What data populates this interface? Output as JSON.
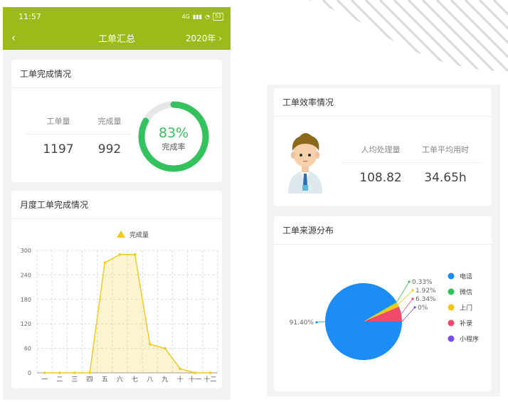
{
  "status": {
    "time": "11:57",
    "network": "4G",
    "battery": "53"
  },
  "nav": {
    "back_icon": "chevron-left-icon",
    "title": "工单汇总",
    "year": "2020年",
    "next_icon": "chevron-right-icon"
  },
  "completion": {
    "title": "工单完成情况",
    "total_label": "工单量",
    "total_value": "1197",
    "done_label": "完成量",
    "done_value": "992",
    "percent_text": "83%",
    "percent": 83,
    "rate_label": "完成率",
    "color": "#34c25e"
  },
  "monthly": {
    "title": "月度工单完成情况"
  },
  "efficiency": {
    "title": "工单效率情况",
    "avg_label": "人均处理量",
    "avg_value": "108.82",
    "time_label": "工单平均用时",
    "time_value": "34.65h"
  },
  "source": {
    "title": "工单来源分布"
  },
  "chart_data": [
    {
      "type": "area",
      "legend": [
        "完成量"
      ],
      "categories": [
        "一",
        "二",
        "三",
        "四",
        "五",
        "六",
        "七",
        "八",
        "九",
        "十",
        "十一",
        "十二"
      ],
      "series": [
        {
          "name": "完成量",
          "values": [
            0,
            0,
            0,
            0,
            270,
            290,
            290,
            70,
            60,
            10,
            0,
            0
          ]
        }
      ],
      "yticks": [
        "0",
        "60",
        "120",
        "180",
        "240",
        "300"
      ],
      "ylim": [
        0,
        300
      ],
      "grid": true,
      "legend_position": "top-center",
      "color": "#f2c925"
    },
    {
      "type": "pie",
      "labels": [
        "电话",
        "微信",
        "上门",
        "补录",
        "小程序"
      ],
      "values": [
        91.4,
        0.33,
        1.92,
        6.34,
        0
      ],
      "label_texts": [
        "91.40%",
        "0.33%",
        "1.92%",
        "6.34%",
        "0%"
      ],
      "colors": [
        "#1b8df5",
        "#34c25e",
        "#f5c71a",
        "#ef4a6c",
        "#7b4ee0"
      ],
      "legend_position": "right"
    }
  ]
}
